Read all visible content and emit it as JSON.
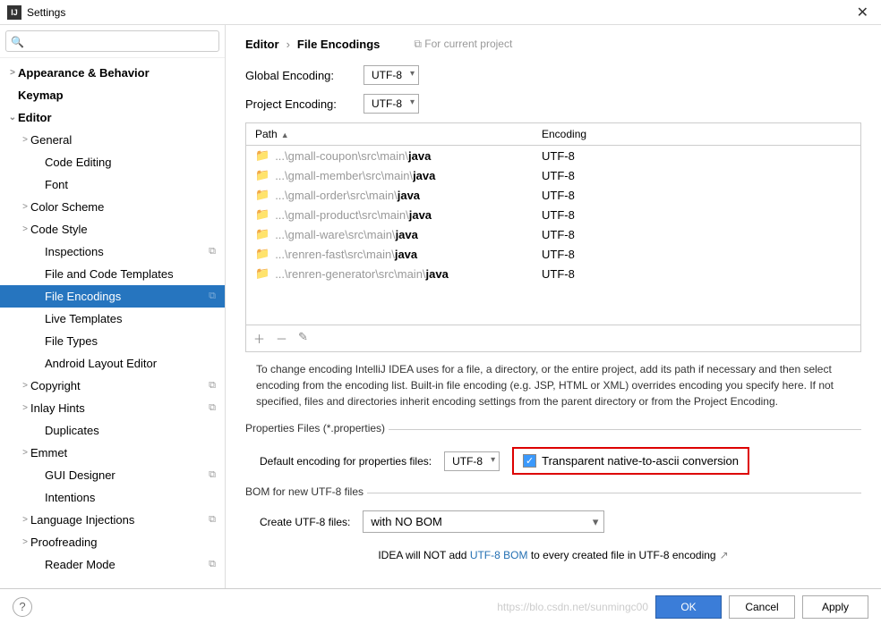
{
  "window": {
    "title": "Settings",
    "app_icon_text": "IJ"
  },
  "search": {
    "placeholder": ""
  },
  "sidebar": {
    "items": [
      {
        "label": "Appearance & Behavior",
        "chev": ">",
        "indent": 0,
        "bold": true
      },
      {
        "label": "Keymap",
        "chev": "",
        "indent": 0,
        "bold": true
      },
      {
        "label": "Editor",
        "chev": "⌄",
        "indent": 0,
        "bold": true
      },
      {
        "label": "General",
        "chev": ">",
        "indent": 1
      },
      {
        "label": "Code Editing",
        "chev": "",
        "indent": 2
      },
      {
        "label": "Font",
        "chev": "",
        "indent": 2
      },
      {
        "label": "Color Scheme",
        "chev": ">",
        "indent": 1
      },
      {
        "label": "Code Style",
        "chev": ">",
        "indent": 1
      },
      {
        "label": "Inspections",
        "chev": "",
        "indent": 2,
        "badge": true
      },
      {
        "label": "File and Code Templates",
        "chev": "",
        "indent": 2
      },
      {
        "label": "File Encodings",
        "chev": "",
        "indent": 2,
        "selected": true,
        "badge": true
      },
      {
        "label": "Live Templates",
        "chev": "",
        "indent": 2
      },
      {
        "label": "File Types",
        "chev": "",
        "indent": 2
      },
      {
        "label": "Android Layout Editor",
        "chev": "",
        "indent": 2
      },
      {
        "label": "Copyright",
        "chev": ">",
        "indent": 1,
        "badge": true
      },
      {
        "label": "Inlay Hints",
        "chev": ">",
        "indent": 1,
        "badge": true
      },
      {
        "label": "Duplicates",
        "chev": "",
        "indent": 2
      },
      {
        "label": "Emmet",
        "chev": ">",
        "indent": 1
      },
      {
        "label": "GUI Designer",
        "chev": "",
        "indent": 2,
        "badge": true
      },
      {
        "label": "Intentions",
        "chev": "",
        "indent": 2
      },
      {
        "label": "Language Injections",
        "chev": ">",
        "indent": 1,
        "badge": true
      },
      {
        "label": "Proofreading",
        "chev": ">",
        "indent": 1
      },
      {
        "label": "Reader Mode",
        "chev": "",
        "indent": 2,
        "badge": true
      }
    ]
  },
  "breadcrumb": {
    "a": "Editor",
    "b": "File Encodings",
    "tag": "For current project"
  },
  "globalEncoding": {
    "label": "Global Encoding:",
    "value": "UTF-8"
  },
  "projectEncoding": {
    "label": "Project Encoding:",
    "value": "UTF-8"
  },
  "table": {
    "col1": "Path",
    "col2": "Encoding",
    "rows": [
      {
        "dim": "...\\gmall-coupon\\src\\main\\",
        "bold": "java",
        "enc": "UTF-8"
      },
      {
        "dim": "...\\gmall-member\\src\\main\\",
        "bold": "java",
        "enc": "UTF-8"
      },
      {
        "dim": "...\\gmall-order\\src\\main\\",
        "bold": "java",
        "enc": "UTF-8"
      },
      {
        "dim": "...\\gmall-product\\src\\main\\",
        "bold": "java",
        "enc": "UTF-8"
      },
      {
        "dim": "...\\gmall-ware\\src\\main\\",
        "bold": "java",
        "enc": "UTF-8"
      },
      {
        "dim": "...\\renren-fast\\src\\main\\",
        "bold": "java",
        "enc": "UTF-8"
      },
      {
        "dim": "...\\renren-generator\\src\\main\\",
        "bold": "java",
        "enc": "UTF-8"
      }
    ]
  },
  "helpText": "To change encoding IntelliJ IDEA uses for a file, a directory, or the entire project, add its path if necessary and then select encoding from the encoding list. Built-in file encoding (e.g. JSP, HTML or XML) overrides encoding you specify here. If not specified, files and directories inherit encoding settings from the parent directory or from the Project Encoding.",
  "propFiles": {
    "title": "Properties Files (*.properties)",
    "label": "Default encoding for properties files:",
    "value": "UTF-8",
    "checkboxLabel": "Transparent native-to-ascii conversion"
  },
  "bom": {
    "title": "BOM for new UTF-8 files",
    "label": "Create UTF-8 files:",
    "value": "with NO BOM",
    "note1": "IDEA will NOT add ",
    "link": "UTF-8 BOM",
    "note2": " to every created file in UTF-8 encoding"
  },
  "buttons": {
    "ok": "OK",
    "cancel": "Cancel",
    "apply": "Apply"
  },
  "watermark": "https://blo.csdn.net/sunmingc00"
}
